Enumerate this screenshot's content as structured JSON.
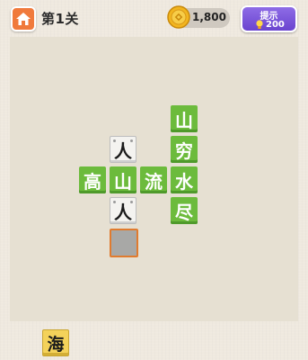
{
  "header": {
    "level_title": "第1关",
    "coins": "1,800",
    "hint_label": "提示",
    "hint_cost": "200"
  },
  "board": {
    "tiles": [
      {
        "char": "山",
        "style": "green"
      },
      {
        "char": "穷",
        "style": "green"
      },
      {
        "char": "人",
        "style": "white"
      },
      {
        "char": "高",
        "style": "green"
      },
      {
        "char": "山",
        "style": "green"
      },
      {
        "char": "流",
        "style": "green"
      },
      {
        "char": "水",
        "style": "green"
      },
      {
        "char": "尽",
        "style": "green"
      },
      {
        "char": "人",
        "style": "white"
      }
    ]
  },
  "char_bank": [
    "海"
  ],
  "colors": {
    "accent_green": "#6cbb3c",
    "home_orange": "#f07a3c",
    "hint_purple": "#7a55d9",
    "selected_border": "#e07b2f",
    "bank_yellow": "#f4d25a"
  }
}
